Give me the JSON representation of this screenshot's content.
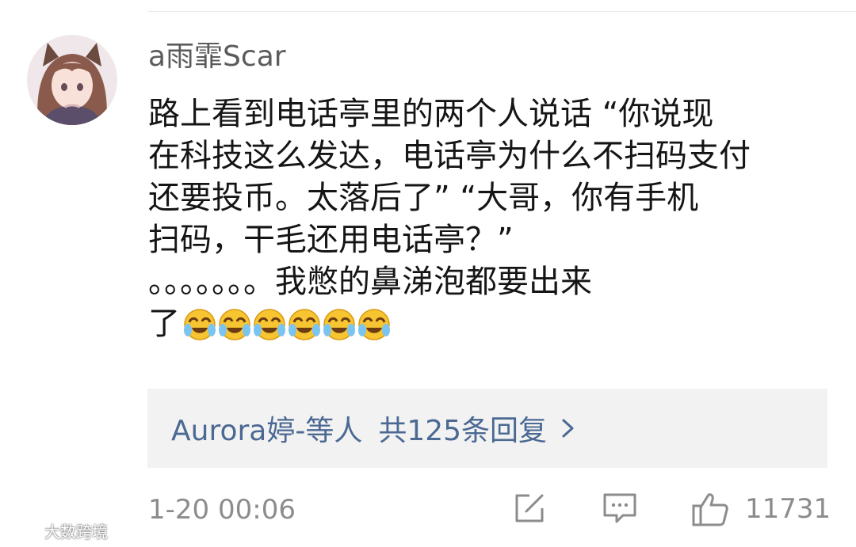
{
  "comment": {
    "username": "a雨霏Scar",
    "lines": [
      "路上看到电话亭里的两个人说话 “你说现",
      "在科技这么发达，电话亭为什么不扫码支付",
      "还要投币。太落后了” “大哥，你有手机",
      "扫码，干毛还用电话亭？”",
      "。。。。。。。我憋的鼻涕泡都要出来",
      "了"
    ],
    "emoji": [
      "crying-laughing-emoji",
      "crying-laughing-emoji",
      "crying-laughing-emoji",
      "crying-laughing-emoji",
      "crying-laughing-emoji",
      "crying-laughing-emoji"
    ],
    "avatar_icon": "anime-girl-avatar"
  },
  "replies": {
    "author": "Aurora婷-等人",
    "count_text": "共125条回复",
    "chevron_icon": "chevron-right-icon"
  },
  "footer": {
    "timestamp": "1-20 00:06",
    "share_icon": "edit-share-icon",
    "reply_icon": "comment-bubble-icon",
    "like_icon": "thumbs-up-icon",
    "like_count": "11731"
  },
  "watermark": {
    "text": "大数跨境",
    "logo_icon": "watermark-logo-icon"
  },
  "colors": {
    "link": "#4b6993",
    "meta": "#8c8c8c",
    "username": "#5b5b5b",
    "reply_bg": "#f2f2f2"
  }
}
